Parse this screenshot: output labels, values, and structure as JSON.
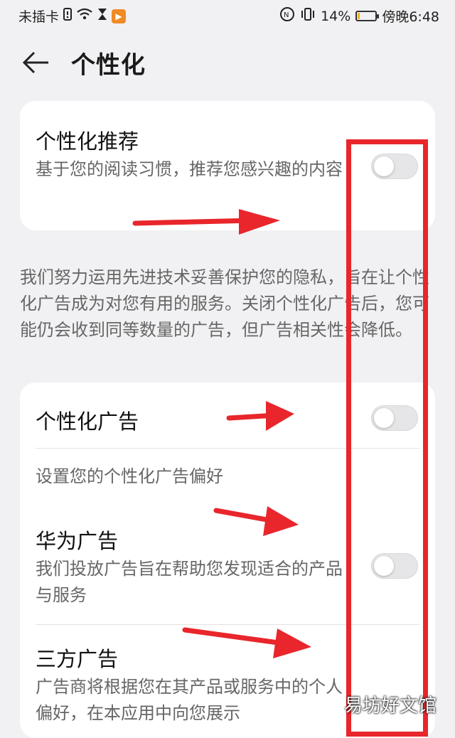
{
  "status_bar": {
    "carrier": "未插卡",
    "battery_percent": "14%",
    "battery_level": 0.14,
    "time": "傍晚6:48",
    "icons": [
      "alert-icon",
      "wifi-icon",
      "hourglass-icon",
      "video-app-icon",
      "nfc-icon",
      "vibrate-icon",
      "battery-icon"
    ]
  },
  "header": {
    "title": "个性化"
  },
  "personal_recommend": {
    "title": "个性化推荐",
    "subtitle": "基于您的阅读习惯，推荐您感兴趣的内容",
    "enabled": false
  },
  "description": "我们努力运用先进技术妥善保护您的隐私，旨在让个性化广告成为对您有用的服务。关闭个性化广告后，您可能仍会收到同等数量的广告，但广告相关性会降低。",
  "ads_section": {
    "personal_ads": {
      "title": "个性化广告",
      "enabled": false
    },
    "preference_label": "设置您的个性化广告偏好",
    "huawei_ads": {
      "title": "华为广告",
      "subtitle": "我们投放广告旨在帮助您发现适合的产品与服务",
      "enabled": false
    },
    "third_party_ads": {
      "title": "三方广告",
      "subtitle": "广告商将根据您在其产品或服务中的个人偏好，在本应用中向您展示"
    }
  },
  "watermark": "易坊好文馆",
  "colors": {
    "annotation_red": "#e8262c",
    "background": "#f1f1f3",
    "card": "#ffffff"
  }
}
